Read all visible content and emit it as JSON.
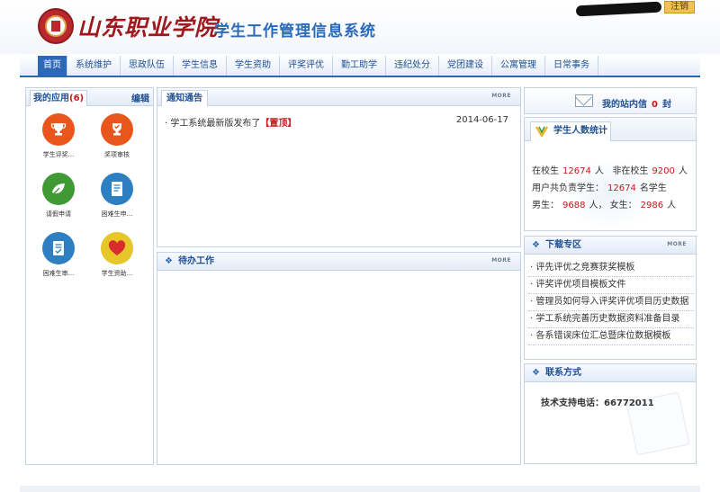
{
  "header": {
    "school_name": "山东职业学院",
    "system_title": "学生工作管理信息系统",
    "logout_label": "注销"
  },
  "nav": {
    "items": [
      "首页",
      "系统维护",
      "思政队伍",
      "学生信息",
      "学生资助",
      "评奖评优",
      "勤工助学",
      "违纪处分",
      "党团建设",
      "公寓管理",
      "日常事务"
    ]
  },
  "apps": {
    "title": "我的应用",
    "count": "(6)",
    "edit_label": "编辑",
    "items": [
      {
        "label": "学生评奖...",
        "color": "#e8561d",
        "icon": "trophy-icon"
      },
      {
        "label": "奖项审核",
        "color": "#e8561d",
        "icon": "trophy-check-icon"
      },
      {
        "label": "请假申请",
        "color": "#3f9a36",
        "icon": "leaf-icon"
      },
      {
        "label": "困难生申...",
        "color": "#2e7fc1",
        "icon": "document-icon"
      },
      {
        "label": "困难生审...",
        "color": "#2e7fc1",
        "icon": "document-check-icon"
      },
      {
        "label": "学生资助...",
        "color": "#e7c62a",
        "icon": "heart-icon"
      }
    ]
  },
  "notice": {
    "title": "通知通告",
    "more": "MORE",
    "items": [
      {
        "text": "学工系统最新版发布了",
        "tag": "【置顶】",
        "date": "2014-06-17"
      }
    ]
  },
  "todo": {
    "title": "待办工作",
    "more": "MORE"
  },
  "messages": {
    "label": "我的站内信",
    "count": "0",
    "unit": "封"
  },
  "stats": {
    "title": "学生人数统计",
    "in_school_label": "在校生",
    "in_school_value": "12674",
    "person_unit": "人",
    "not_in_school_label": "非在校生",
    "not_in_school_value": "9200",
    "responsible_label": "用户共负责学生：",
    "responsible_value": "12674",
    "responsible_unit": "名学生",
    "male_label": "男生：",
    "male_value": "9688",
    "female_label": "女生：",
    "female_value": "2986"
  },
  "downloads": {
    "title": "下载专区",
    "more": "MORE",
    "items": [
      "评先评优之竞赛获奖模板",
      "评奖评优项目模板文件",
      "管理员如何导入评奖评优项目历史数据",
      "学工系统完善历史数据资料准备目录",
      "各系错误床位汇总暨床位数据模板"
    ]
  },
  "contact": {
    "title": "联系方式",
    "support_label": "技术支持电话：",
    "support_phone": "66772011"
  },
  "colors": {
    "brand_blue": "#2c67b3",
    "brand_red": "#a0181b",
    "highlight_red": "#c41a1a"
  }
}
